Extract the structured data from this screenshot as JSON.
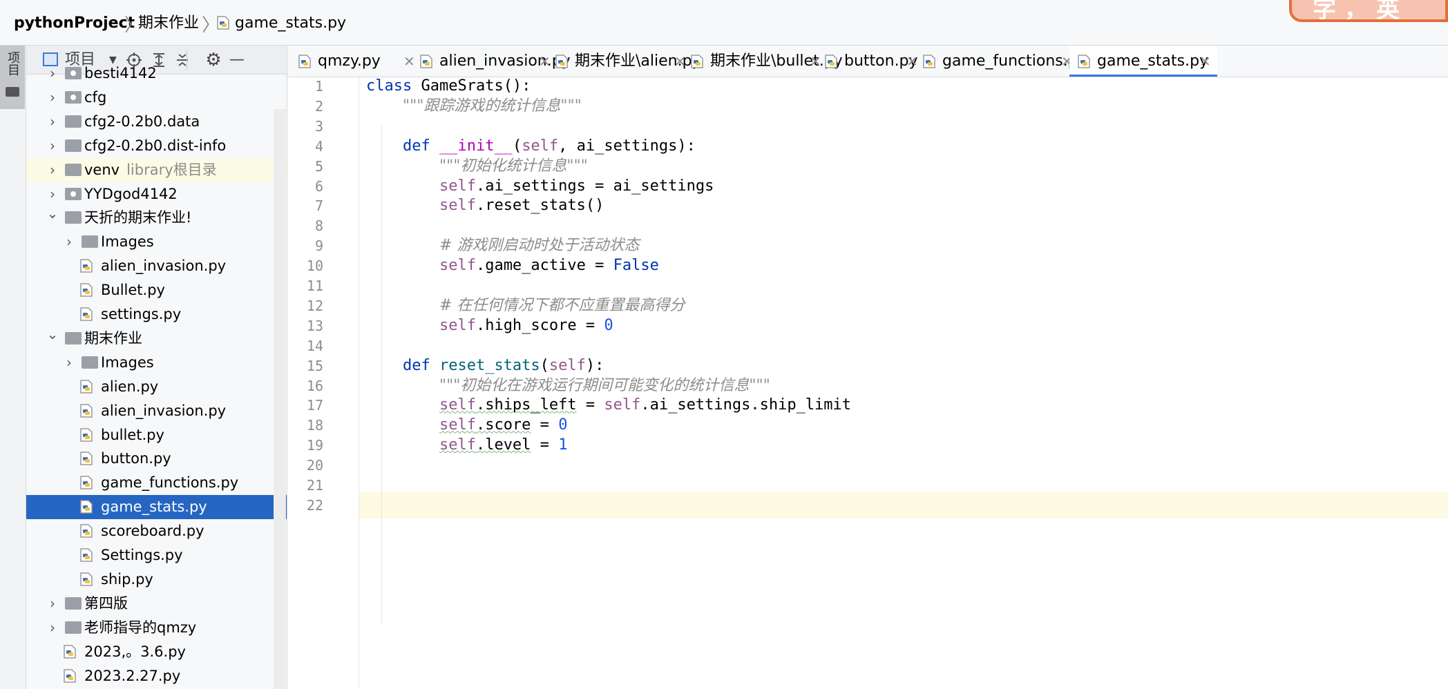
{
  "breadcrumb": {
    "project": "pythonProject",
    "folder": "期末作业",
    "file": "game_stats.py"
  },
  "corner_deco_text": "字，英",
  "tool_strip": {
    "project_label": "项目"
  },
  "project_panel": {
    "view_label": "项目",
    "icons": [
      "locate-icon",
      "expand-all-icon",
      "collapse-all-icon",
      "gear-icon",
      "minimize-icon"
    ],
    "tree": [
      {
        "label": "besti4142",
        "hint": "",
        "kind": "folder-mod",
        "depth": 0,
        "arrow": "right"
      },
      {
        "label": "cfg",
        "hint": "",
        "kind": "folder-mod",
        "depth": 0,
        "arrow": "right"
      },
      {
        "label": "cfg2-0.2b0.data",
        "hint": "",
        "kind": "folder",
        "depth": 0,
        "arrow": "right"
      },
      {
        "label": "cfg2-0.2b0.dist-info",
        "hint": "",
        "kind": "folder",
        "depth": 0,
        "arrow": "right"
      },
      {
        "label": "venv",
        "hint": "library根目录",
        "kind": "folder",
        "depth": 0,
        "arrow": "right"
      },
      {
        "label": "YYDgod4142",
        "hint": "",
        "kind": "folder-mod",
        "depth": 0,
        "arrow": "right"
      },
      {
        "label": "天折的期末作业!",
        "hint": "",
        "kind": "folder",
        "depth": 0,
        "arrow": "down"
      },
      {
        "label": "Images",
        "hint": "",
        "kind": "folder",
        "depth": 1,
        "arrow": "right"
      },
      {
        "label": "alien_invasion.py",
        "hint": "",
        "kind": "py",
        "depth": 1,
        "arrow": ""
      },
      {
        "label": "Bullet.py",
        "hint": "",
        "kind": "py",
        "depth": 1,
        "arrow": ""
      },
      {
        "label": "settings.py",
        "hint": "",
        "kind": "py",
        "depth": 1,
        "arrow": ""
      },
      {
        "label": "期末作业",
        "hint": "",
        "kind": "folder",
        "depth": 0,
        "arrow": "down"
      },
      {
        "label": "Images",
        "hint": "",
        "kind": "folder",
        "depth": 1,
        "arrow": "right"
      },
      {
        "label": "alien.py",
        "hint": "",
        "kind": "py",
        "depth": 1,
        "arrow": ""
      },
      {
        "label": "alien_invasion.py",
        "hint": "",
        "kind": "py",
        "depth": 1,
        "arrow": ""
      },
      {
        "label": "bullet.py",
        "hint": "",
        "kind": "py",
        "depth": 1,
        "arrow": ""
      },
      {
        "label": "button.py",
        "hint": "",
        "kind": "py",
        "depth": 1,
        "arrow": ""
      },
      {
        "label": "game_functions.py",
        "hint": "",
        "kind": "py",
        "depth": 1,
        "arrow": ""
      },
      {
        "label": "game_stats.py",
        "hint": "",
        "kind": "py",
        "depth": 1,
        "arrow": "",
        "selected": true
      },
      {
        "label": "scoreboard.py",
        "hint": "",
        "kind": "py",
        "depth": 1,
        "arrow": ""
      },
      {
        "label": "Settings.py",
        "hint": "",
        "kind": "py",
        "depth": 1,
        "arrow": ""
      },
      {
        "label": "ship.py",
        "hint": "",
        "kind": "py",
        "depth": 1,
        "arrow": ""
      },
      {
        "label": "第四版",
        "hint": "",
        "kind": "folder",
        "depth": 0,
        "arrow": "right"
      },
      {
        "label": "老师指导的qmzy",
        "hint": "",
        "kind": "folder",
        "depth": 0,
        "arrow": "right"
      },
      {
        "label": "2023,。3.6.py",
        "hint": "",
        "kind": "py",
        "depth": 0,
        "arrow": ""
      },
      {
        "label": "2023.2.27.py",
        "hint": "",
        "kind": "py",
        "depth": 0,
        "arrow": ""
      }
    ]
  },
  "tabs": [
    {
      "label": "qmzy.py",
      "active": false
    },
    {
      "label": "alien_invasion.py",
      "active": false
    },
    {
      "label": "期末作业\\alien.py",
      "active": false
    },
    {
      "label": "期末作业\\bullet.py",
      "active": false
    },
    {
      "label": "button.py",
      "active": false
    },
    {
      "label": "game_functions.py",
      "active": false
    },
    {
      "label": "game_stats.py",
      "active": true
    }
  ],
  "editor": {
    "current_line": 22,
    "lines": [
      [
        {
          "t": "class ",
          "c": "kw"
        },
        {
          "t": "GameSrats():",
          "c": ""
        }
      ],
      [
        {
          "t": "    ",
          "c": ""
        },
        {
          "t": "\"\"\"跟踪游戏的统计信息\"\"\"",
          "c": "doc"
        }
      ],
      [],
      [
        {
          "t": "    ",
          "c": ""
        },
        {
          "t": "def ",
          "c": "kw"
        },
        {
          "t": "__init__",
          "c": "dunder"
        },
        {
          "t": "(",
          "c": ""
        },
        {
          "t": "self",
          "c": "self"
        },
        {
          "t": ", ai_settings):",
          "c": ""
        }
      ],
      [
        {
          "t": "        ",
          "c": ""
        },
        {
          "t": "\"\"\"初始化统计信息\"\"\"",
          "c": "doc"
        }
      ],
      [
        {
          "t": "        ",
          "c": ""
        },
        {
          "t": "self",
          "c": "self"
        },
        {
          "t": ".ai_settings = ai_settings",
          "c": ""
        }
      ],
      [
        {
          "t": "        ",
          "c": ""
        },
        {
          "t": "self",
          "c": "self"
        },
        {
          "t": ".reset_stats()",
          "c": ""
        }
      ],
      [],
      [
        {
          "t": "        ",
          "c": ""
        },
        {
          "t": "# 游戏刚启动时处于活动状态",
          "c": "cmt"
        }
      ],
      [
        {
          "t": "        ",
          "c": ""
        },
        {
          "t": "self",
          "c": "self"
        },
        {
          "t": ".game_active = ",
          "c": ""
        },
        {
          "t": "False",
          "c": "kw"
        }
      ],
      [],
      [
        {
          "t": "        ",
          "c": ""
        },
        {
          "t": "# 在任何情况下都不应重置最高得分",
          "c": "cmt"
        }
      ],
      [
        {
          "t": "        ",
          "c": ""
        },
        {
          "t": "self",
          "c": "self"
        },
        {
          "t": ".high_score = ",
          "c": ""
        },
        {
          "t": "0",
          "c": "num"
        }
      ],
      [],
      [
        {
          "t": "    ",
          "c": ""
        },
        {
          "t": "def ",
          "c": "kw"
        },
        {
          "t": "reset_stats",
          "c": "fn"
        },
        {
          "t": "(",
          "c": ""
        },
        {
          "t": "self",
          "c": "self"
        },
        {
          "t": "):",
          "c": ""
        }
      ],
      [
        {
          "t": "        ",
          "c": ""
        },
        {
          "t": "\"\"\"初始化在游戏运行期间可能变化的统计信息\"\"\"",
          "c": "doc"
        }
      ],
      [
        {
          "t": "        ",
          "c": ""
        },
        {
          "t": "self",
          "c": "self squiggle"
        },
        {
          "t": ".ships_left",
          "c": "squiggle"
        },
        {
          "t": " = ",
          "c": ""
        },
        {
          "t": "self",
          "c": "self"
        },
        {
          "t": ".ai_settings.ship_limit",
          "c": ""
        }
      ],
      [
        {
          "t": "        ",
          "c": ""
        },
        {
          "t": "self",
          "c": "self squiggle"
        },
        {
          "t": ".score",
          "c": "squiggle"
        },
        {
          "t": " = ",
          "c": ""
        },
        {
          "t": "0",
          "c": "num"
        }
      ],
      [
        {
          "t": "        ",
          "c": ""
        },
        {
          "t": "self",
          "c": "self squiggle"
        },
        {
          "t": ".level",
          "c": "squiggle"
        },
        {
          "t": " = ",
          "c": ""
        },
        {
          "t": "1",
          "c": "num"
        }
      ],
      [],
      [],
      []
    ]
  }
}
